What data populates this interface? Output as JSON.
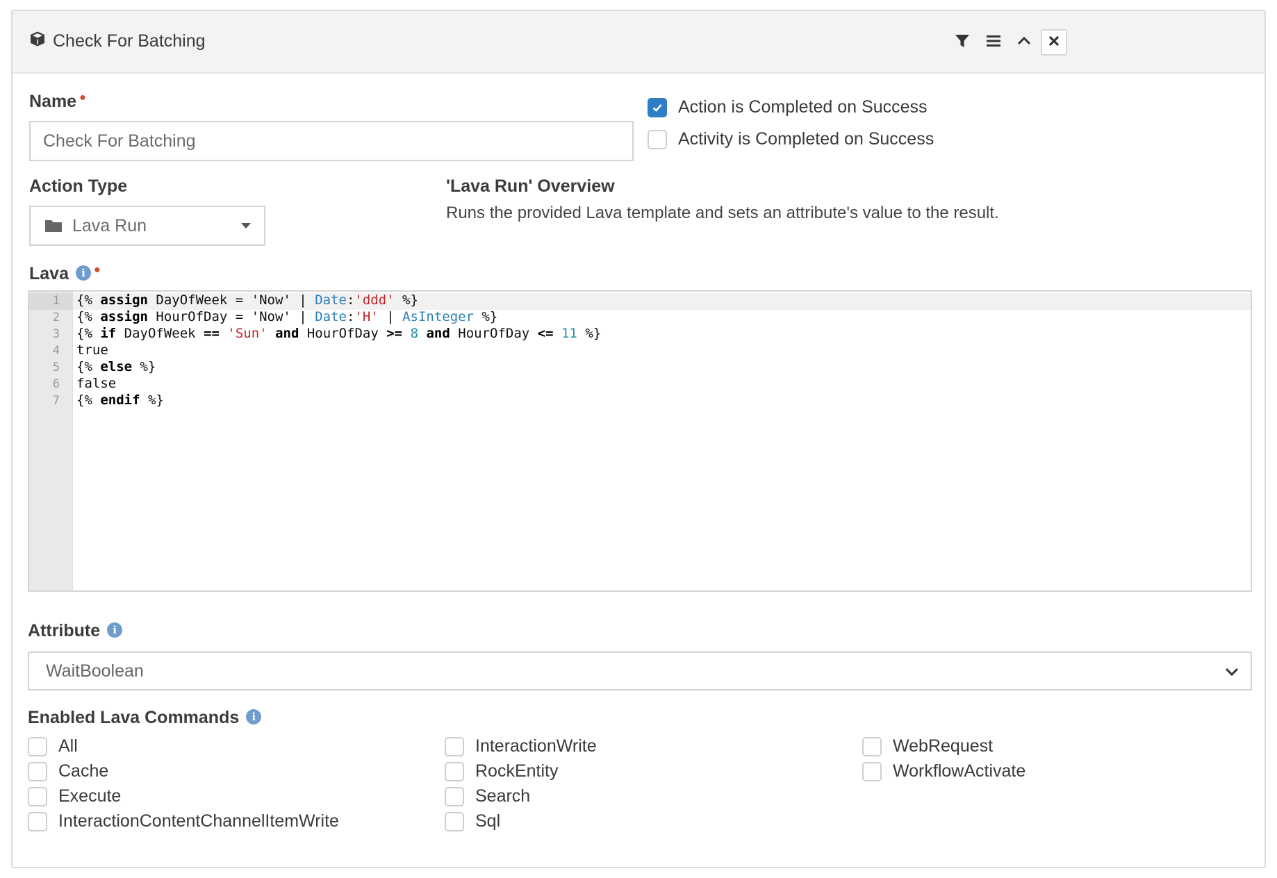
{
  "panel": {
    "title": "Check For Batching",
    "icon": "cube-icon",
    "header_buttons": [
      "filter-icon",
      "menu-icon",
      "chevron-up-icon",
      "close-icon"
    ]
  },
  "name_field": {
    "label": "Name",
    "value": "Check For Batching"
  },
  "options": [
    {
      "label": "Action is Completed on Success",
      "checked": true
    },
    {
      "label": "Activity is Completed on Success",
      "checked": false
    }
  ],
  "action_type": {
    "label": "Action Type",
    "value": "Lava Run",
    "icon": "folder-icon"
  },
  "overview": {
    "title": "'Lava Run' Overview",
    "text": "Runs the provided Lava template and sets an attribute's value to the result."
  },
  "lava": {
    "label": "Lava",
    "line_numbers": [
      "1",
      "2",
      "3",
      "4",
      "5",
      "6",
      "7"
    ],
    "lines": [
      "{% assign DayOfWeek = 'Now' | Date:'ddd' %}",
      "{% assign HourOfDay = 'Now' | Date:'H' | AsInteger %}",
      "{% if DayOfWeek == 'Sun' and HourOfDay >= 8 and HourOfDay <= 11 %}",
      "true",
      "{% else %}",
      "false",
      "{% endif %}"
    ]
  },
  "attribute": {
    "label": "Attribute",
    "value": "WaitBoolean"
  },
  "enabled_commands": {
    "label": "Enabled Lava Commands",
    "columns": [
      [
        "All",
        "Cache",
        "Execute",
        "InteractionContentChannelItemWrite"
      ],
      [
        "InteractionWrite",
        "RockEntity",
        "Search",
        "Sql"
      ],
      [
        "WebRequest",
        "WorkflowActivate"
      ]
    ]
  },
  "colors": {
    "accent": "#2f7dc6",
    "required": "#d04a2b",
    "info": "#6f9ccc",
    "header_bg": "#f3f3f3"
  }
}
